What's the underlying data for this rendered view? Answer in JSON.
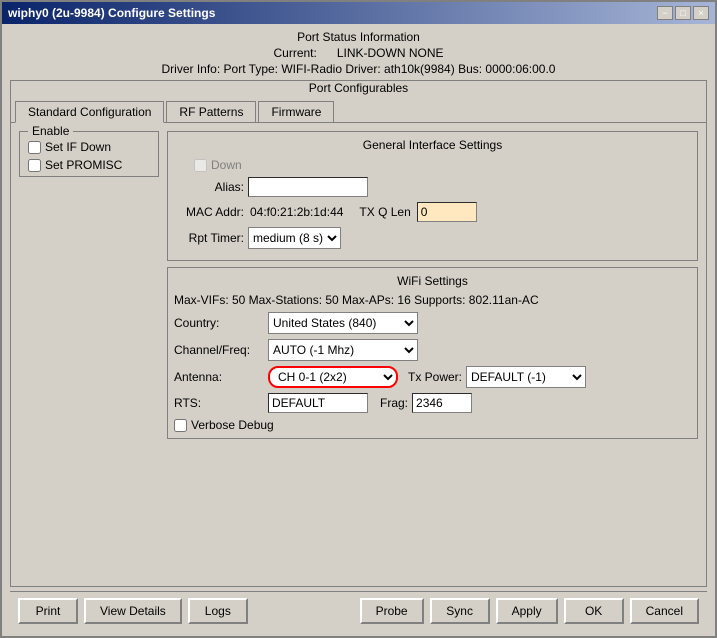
{
  "window": {
    "title": "wiphy0  (2u-9984) Configure Settings",
    "min_btn": "−",
    "max_btn": "□",
    "close_btn": "×"
  },
  "port_status": {
    "section_title": "Port Status Information",
    "current_label": "Current:",
    "current_value": "LINK-DOWN  NONE",
    "driver_label": "Driver Info:",
    "driver_value": "Port Type: WIFI-Radio  Driver: ath10k(9984)  Bus: 0000:06:00.0"
  },
  "port_configurables": {
    "title": "Port Configurables"
  },
  "tabs": [
    {
      "id": "standard",
      "label": "Standard Configuration",
      "active": true
    },
    {
      "id": "rf",
      "label": "RF Patterns",
      "active": false
    },
    {
      "id": "firmware",
      "label": "Firmware",
      "active": false
    }
  ],
  "enable_group": {
    "legend": "Enable",
    "set_if_down_label": "Set IF Down",
    "set_promisc_label": "Set PROMISC"
  },
  "general": {
    "title": "General Interface Settings",
    "down_label": "Down",
    "alias_label": "Alias:",
    "alias_value": "",
    "mac_label": "MAC Addr:",
    "mac_value": "04:f0:21:2b:1d:44",
    "txq_label": "TX Q Len",
    "txq_value": "0",
    "rpt_label": "Rpt Timer:",
    "rpt_value": "medium  (8 s)"
  },
  "wifi": {
    "title": "WiFi Settings",
    "info": "Max-VIFs: 50  Max-Stations: 50  Max-APs: 16  Supports: 802.11an-AC",
    "country_label": "Country:",
    "country_value": "United States (840)",
    "channel_label": "Channel/Freq:",
    "channel_value": "AUTO (-1 Mhz)",
    "antenna_label": "Antenna:",
    "antenna_value": "CH 0-1 (2x2)",
    "tx_power_label": "Tx Power:",
    "tx_power_value": "DEFAULT (-1)",
    "rts_label": "RTS:",
    "rts_value": "DEFAULT",
    "frag_label": "Frag:",
    "frag_value": "2346",
    "verbose_label": "Verbose Debug"
  },
  "buttons": {
    "print": "Print",
    "view_details": "View Details",
    "logs": "Logs",
    "probe": "Probe",
    "sync": "Sync",
    "apply": "Apply",
    "ok": "OK",
    "cancel": "Cancel"
  }
}
